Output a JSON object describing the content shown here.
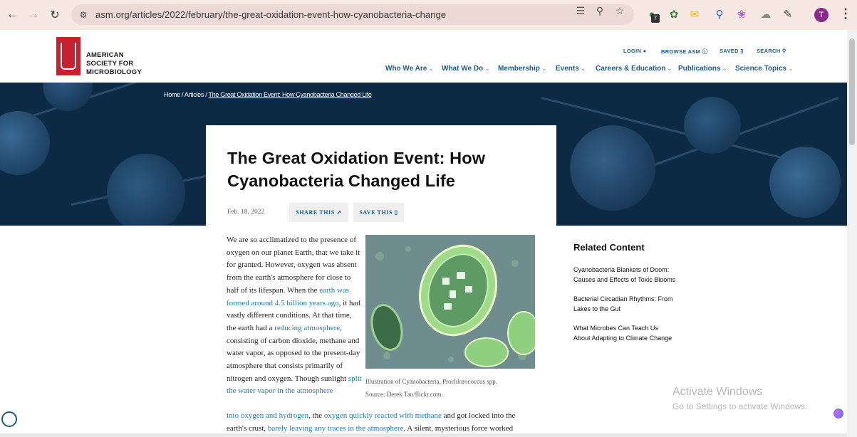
{
  "browser": {
    "url": "asm.org/articles/2022/february/the-great-oxidation-event-how-cyanobacteria-change",
    "ext_badge_1": "7",
    "avatar_letter": "T"
  },
  "header": {
    "logo_line1": "AMERICAN",
    "logo_line2": "SOCIETY FOR",
    "logo_line3": "MICROBIOLOGY",
    "util": {
      "login": "LOGIN",
      "browse": "BROWSE ASM",
      "saved": "SAVED",
      "search": "SEARCH"
    },
    "nav": [
      "Who We Are",
      "What We Do",
      "Membership",
      "Events",
      "Careers & Education",
      "Publications",
      "Science Topics"
    ]
  },
  "breadcrumb": {
    "home": "Home",
    "articles": "Articles",
    "current": "The Great Oxidation Event: How Cyanobacteria Changed Life"
  },
  "article": {
    "title": "The Great Oxidation Event: How Cyanobacteria Changed Life",
    "date": "Feb. 18, 2022",
    "share_label": "SHARE THIS",
    "save_label": "SAVE THIS",
    "caption_line1": "Illustration of Cyanobacteria, Prochlorococcus spp.",
    "caption_line2": "Source: Derek Tan/flickr.com.",
    "p_start": "We are so acclimatized to the presence of oxygen on our planet Earth, that we take it for granted. However, oxygen was absent from the earth's atmosphere for close to half of its lifespan. When the ",
    "link1": "earth was formed around 4.5 billion years ago",
    "p_mid1": ", it had vastly different conditions. At that time, the earth had a ",
    "link2": "reducing atmosphere",
    "p_mid2": ", consisting of carbon dioxide, methane and water vapor, as opposed to the present-day atmosphere that consists primarily of nitrogen and oxygen. Though sunlight ",
    "link3": "split the water vapor in the atmosphere",
    "link3b": "into oxygen and hydrogen",
    "p_mid3": ", the ",
    "link4": "oxygen quickly reacted with methane",
    "p_mid4": " and got locked into the",
    "p_line_last_a": "earth's crust, ",
    "link5": "barely leaving any traces in the atmosphere",
    "p_line_last_b": ". A silent, mysterious force worked"
  },
  "sidebar": {
    "heading": "Related Content",
    "items": [
      {
        "line1": "Cyanobacteria Blankets of Doom:",
        "line2": "Causes and Effects of Toxic Blooms"
      },
      {
        "line1": "Bacterial Circadian Rhythms: From",
        "line2": "Lakes to the Gut"
      },
      {
        "line1": "What Microbes Can Teach Us",
        "line2": "About Adapting to Climate Change"
      }
    ]
  },
  "watermark": {
    "line1": "Activate Windows",
    "line2": "Go to Settings to activate Windows."
  }
}
